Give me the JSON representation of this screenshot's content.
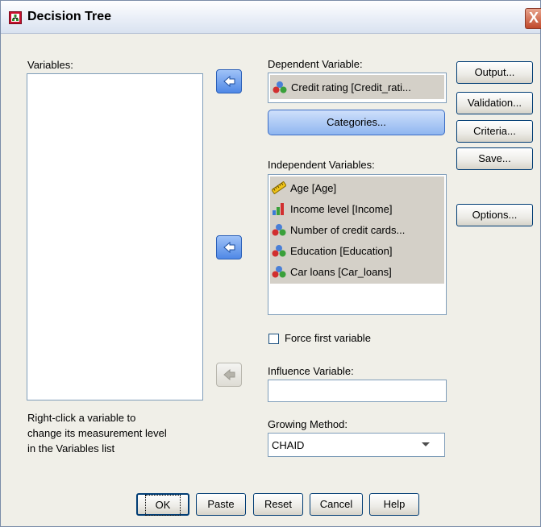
{
  "window": {
    "title": "Decision Tree",
    "close_glyph": "X"
  },
  "variables": {
    "label": "Variables:",
    "hint_line1": "Right-click a variable to",
    "hint_line2": "change its measurement level",
    "hint_line3": "in the Variables list"
  },
  "dependent": {
    "label": "Dependent Variable:",
    "value": "Credit rating [Credit_rati...",
    "categories_button": "Categories..."
  },
  "independent": {
    "label": "Independent Variables:",
    "items": [
      {
        "label": "Age [Age]",
        "icon": "ruler-icon"
      },
      {
        "label": "Income level [Income]",
        "icon": "ordinal-bar-icon"
      },
      {
        "label": "Number of credit cards...",
        "icon": "nominal-balls-icon"
      },
      {
        "label": "Education [Education]",
        "icon": "nominal-balls-icon"
      },
      {
        "label": "Car loans [Car_loans]",
        "icon": "nominal-balls-icon"
      }
    ]
  },
  "force_first": {
    "label": "Force first variable",
    "checked": false
  },
  "influence": {
    "label": "Influence Variable:",
    "value": ""
  },
  "growing": {
    "label": "Growing Method:",
    "selected": "CHAID"
  },
  "side_buttons": {
    "output": "Output...",
    "validation": "Validation...",
    "criteria": "Criteria...",
    "save": "Save...",
    "options": "Options..."
  },
  "bottom_buttons": {
    "ok": "OK",
    "paste": "Paste",
    "reset": "Reset",
    "cancel": "Cancel",
    "help": "Help"
  },
  "colors": {
    "titlebar": "#e9eef7",
    "dialog_bg": "#f0efe8",
    "selection_gray": "#d4d0c8",
    "arrow_blue": "#4f88e6"
  }
}
